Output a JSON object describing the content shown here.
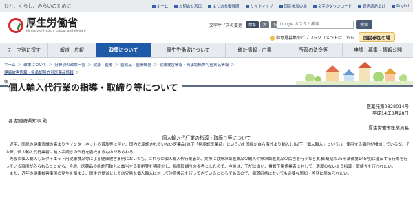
{
  "topbar": {
    "tagline": "ひと、くらし、みらいのために",
    "links": [
      {
        "label": "ホーム"
      },
      {
        "label": "お問合せ窓口"
      },
      {
        "label": "よくある御質問"
      },
      {
        "label": "サイトマップ"
      },
      {
        "label": "国民参加の場"
      },
      {
        "label": "文字のダウンロード"
      },
      {
        "label": "音声読み上げ"
      },
      {
        "label": "English"
      }
    ]
  },
  "header": {
    "logo_jp": "厚生労働省",
    "logo_en": "Ministry of Health, Labour and Welfare",
    "fontsize_label": "文字サイズの変更",
    "fontsize_options": [
      "標準",
      "大",
      "特大"
    ],
    "search_placeholder": "Google カスタム検索",
    "search_button": "検索",
    "sublink_text": "御意見募集やパブリックコメントはこちら",
    "participate_button": "国民参加の場"
  },
  "nav": {
    "items": [
      {
        "label": "テーマ別に探す"
      },
      {
        "label": "報道・広報"
      },
      {
        "label": "政策について"
      },
      {
        "label": "厚生労働省について"
      },
      {
        "label": "統計情報・白書"
      },
      {
        "label": "所管の法令等"
      },
      {
        "label": "申請・募集・情報公開"
      }
    ],
    "active_index": 2
  },
  "breadcrumb": {
    "items": [
      "ホーム",
      "政策について",
      "分野別の政策一覧",
      "健康・医療",
      "医薬品・医療機器",
      "健康被害情報・無承認無許可医薬品情報",
      "健康被害情報・無承認無許可医薬品情報"
    ],
    "current": "個人輸入代行業の指導・取締り等について"
  },
  "page_title": "個人輸入代行業の指導・取締り等について",
  "document": {
    "ref_number": "医薬発第0828014号",
    "ref_date": "平成14年8月28日",
    "addressee": "各 都道府県知事 殿",
    "sender": "厚生労働省医薬局長",
    "heading": "個人輸入代行業の指導・取締り等について",
    "paragraphs": [
      "　近年、国民の健康意識の高まりやインターネットの普及等に伴い、国内で承認されていない医薬品(以下「無承認医薬品」という。)を国民が自ら海外より輸入し(以下「個人輸入」という。)、使用する事例が増加しているが、その際、個人輸入代行業者に輸入手続きの代行を委託するものがみられる。",
      "　先般の個人輸入したダイエット用健康食品等による健康被害事例においても、これらの個人輸入代行業者が、実際には無承認医薬品の輸入や無承認医薬品の広告を行うなど薬事法(昭和35年法律第145号)に違反する行為を行っている事例がみられることから、今般、医薬品の無許可輸入に該当する事例等を明確化し、指導取締りの参考としたので、今後は、下記に従い、貴管下関係業者に対して、遺漏のないよう指導・取締りを行われたい。",
      "　また、近年の健康被害事例の発生を踏まえ、厚生労働省としては安易な個人輸入に対して注意喚起を行ってきているところであるので、都道府県においても必要な周知・啓発に努められたい。"
    ]
  }
}
